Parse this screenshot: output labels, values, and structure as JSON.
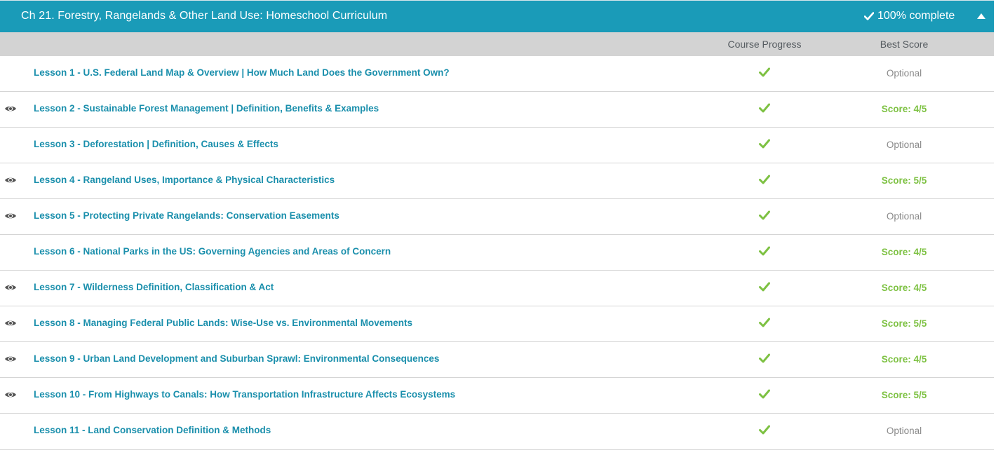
{
  "chapter": {
    "title": "Ch 21. Forestry, Rangelands & Other Land Use: Homeschool Curriculum",
    "completion": "100% complete",
    "check_icon": "checkmark-icon",
    "collapse_icon": "caret-up-icon"
  },
  "columns": {
    "progress": "Course Progress",
    "score": "Best Score"
  },
  "colors": {
    "header_bg": "#1a9bb8",
    "link": "#1a8fac",
    "check": "#7dc142",
    "optional": "#8a8a8a"
  },
  "lessons": [
    {
      "title": "Lesson 1 - U.S. Federal Land Map & Overview | How Much Land Does the Government Own?",
      "viewed": false,
      "complete": true,
      "score": "Optional"
    },
    {
      "title": "Lesson 2 - Sustainable Forest Management | Definition, Benefits & Examples",
      "viewed": true,
      "complete": true,
      "score": "Score: 4/5"
    },
    {
      "title": "Lesson 3 - Deforestation | Definition, Causes & Effects",
      "viewed": false,
      "complete": true,
      "score": "Optional"
    },
    {
      "title": "Lesson 4 - Rangeland Uses, Importance & Physical Characteristics",
      "viewed": true,
      "complete": true,
      "score": "Score: 5/5"
    },
    {
      "title": "Lesson 5 - Protecting Private Rangelands: Conservation Easements",
      "viewed": true,
      "complete": true,
      "score": "Optional"
    },
    {
      "title": "Lesson 6 - National Parks in the US: Governing Agencies and Areas of Concern",
      "viewed": false,
      "complete": true,
      "score": "Score: 4/5"
    },
    {
      "title": "Lesson 7 - Wilderness Definition, Classification & Act",
      "viewed": true,
      "complete": true,
      "score": "Score: 4/5"
    },
    {
      "title": "Lesson 8 - Managing Federal Public Lands: Wise-Use vs. Environmental Movements",
      "viewed": true,
      "complete": true,
      "score": "Score: 5/5"
    },
    {
      "title": "Lesson 9 - Urban Land Development and Suburban Sprawl: Environmental Consequences",
      "viewed": true,
      "complete": true,
      "score": "Score: 4/5"
    },
    {
      "title": "Lesson 10 - From Highways to Canals: How Transportation Infrastructure Affects Ecosystems",
      "viewed": true,
      "complete": true,
      "score": "Score: 5/5"
    },
    {
      "title": "Lesson 11 - Land Conservation Definition & Methods",
      "viewed": false,
      "complete": true,
      "score": "Optional"
    }
  ]
}
